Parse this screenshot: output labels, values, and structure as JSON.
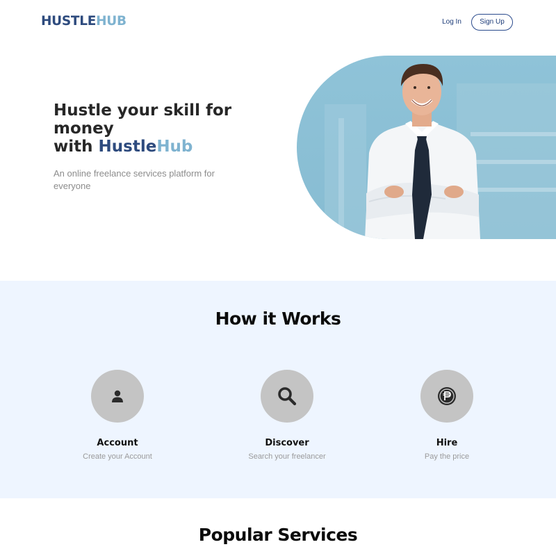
{
  "header": {
    "logo": {
      "part1": "HUSTLE",
      "part2": "HUB"
    },
    "login_label": "Log In",
    "signup_label": "Sign Up"
  },
  "hero": {
    "title_line1": "Hustle your skill for",
    "title_line2": "money",
    "title_line3_prefix": "with ",
    "title_brand1": "Hustle",
    "title_brand2": "Hub",
    "subtitle": "An online freelance services platform for everyone"
  },
  "how_it_works": {
    "title": "How it Works",
    "steps": [
      {
        "icon": "user-icon",
        "title": "Account",
        "description": "Create your Account"
      },
      {
        "icon": "search-icon",
        "title": "Discover",
        "description": "Search your freelancer"
      },
      {
        "icon": "peso-coin-icon",
        "title": "Hire",
        "description": "Pay the price"
      }
    ]
  },
  "popular_services": {
    "title": "Popular Services"
  },
  "colors": {
    "brand_dark": "#2e4b7e",
    "brand_light": "#7fb3d0",
    "section_bg": "#eef5ff",
    "icon_circle": "#c4c4c4"
  }
}
